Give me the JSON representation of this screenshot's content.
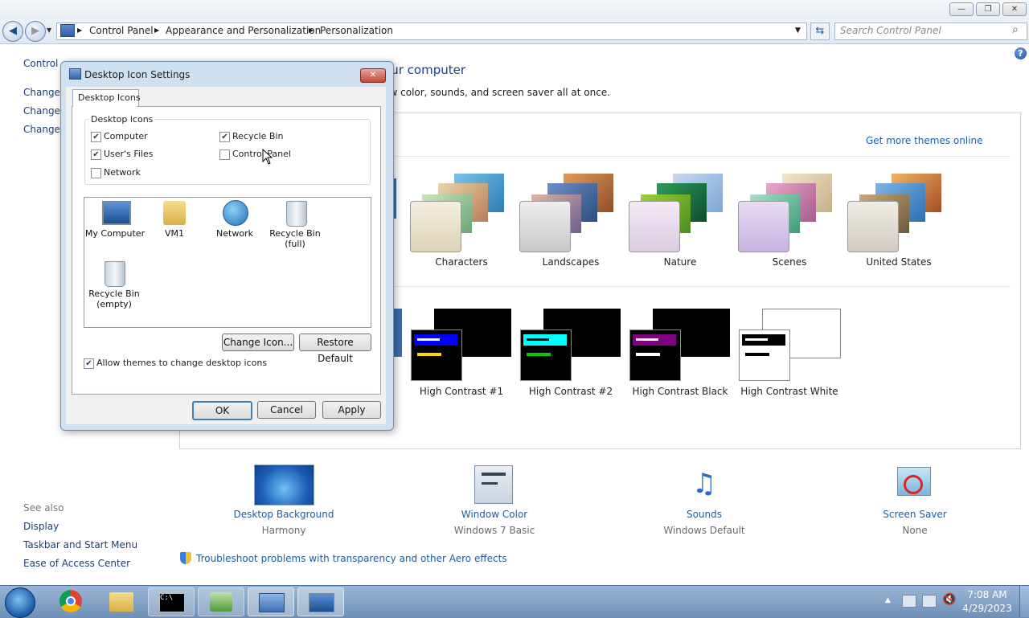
{
  "window": {
    "title_buttons": {
      "minimize": "—",
      "maximize": "❐",
      "close": "✕"
    }
  },
  "address": {
    "crumbs": [
      "Control Panel",
      "Appearance and Personalization",
      "Personalization"
    ],
    "search_placeholder": "Search Control Panel"
  },
  "left_pane": {
    "home": "Control Panel Home",
    "links": [
      "Change desktop icons",
      "Change mouse pointers",
      "Change your account picture"
    ],
    "see_also_heading": "See also",
    "see_also": [
      "Display",
      "Taskbar and Start Menu",
      "Ease of Access Center"
    ]
  },
  "main": {
    "heading": "Change the visuals and sounds on your computer",
    "subtitle": "Click a theme to change the desktop background, window color, sounds, and screen saver all at once.",
    "get_more_themes": "Get more themes online",
    "themes": [
      "Characters",
      "Landscapes",
      "Nature",
      "Scenes",
      "United States"
    ],
    "contrast_themes": [
      "High Contrast #1",
      "High Contrast #2",
      "High Contrast Black",
      "High Contrast White"
    ],
    "bottom": [
      {
        "title": "Desktop Background",
        "value": "Harmony"
      },
      {
        "title": "Window Color",
        "value": "Windows 7 Basic"
      },
      {
        "title": "Sounds",
        "value": "Windows Default"
      },
      {
        "title": "Screen Saver",
        "value": "None"
      }
    ],
    "troubleshoot": "Troubleshoot problems with transparency and other Aero effects"
  },
  "dialog": {
    "title": "Desktop Icon Settings",
    "tab": "Desktop Icons",
    "group_label": "Desktop icons",
    "checkboxes": [
      {
        "label": "Computer",
        "checked": true
      },
      {
        "label": "Recycle Bin",
        "checked": true
      },
      {
        "label": "User's Files",
        "checked": true
      },
      {
        "label": "Control Panel",
        "checked": false
      },
      {
        "label": "Network",
        "checked": false
      }
    ],
    "icons": [
      "My Computer",
      "VM1",
      "Network",
      "Recycle Bin (full)",
      "Recycle Bin (empty)"
    ],
    "change_icon": "Change Icon...",
    "restore_default": "Restore Default",
    "allow_themes": "Allow themes to change desktop icons",
    "allow_themes_checked": true,
    "ok": "OK",
    "cancel": "Cancel",
    "apply": "Apply"
  },
  "taskbar": {
    "time": "7:08 AM",
    "date": "4/29/2023"
  }
}
